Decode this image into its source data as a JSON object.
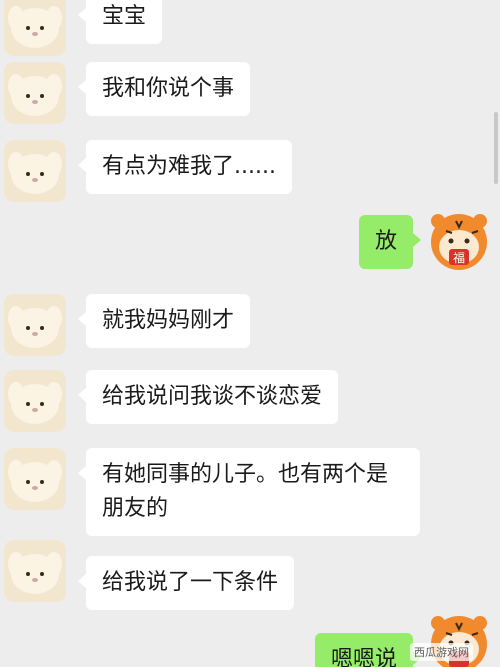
{
  "colors": {
    "background": "#ededed",
    "incoming_bubble": "#ffffff",
    "outgoing_bubble": "#95ec69"
  },
  "contact_avatar_icon": "puppy-sticker-avatar",
  "self_avatar_icon": "tiger-fu-avatar",
  "self_avatar_text": "福",
  "messages": [
    {
      "side": "in",
      "text": "宝宝"
    },
    {
      "side": "in",
      "text": "我和你说个事"
    },
    {
      "side": "in",
      "text": "有点为难我了......"
    },
    {
      "side": "out",
      "text": "放"
    },
    {
      "side": "in",
      "text": "就我妈妈刚才"
    },
    {
      "side": "in",
      "text": "给我说问我谈不谈恋爱"
    },
    {
      "side": "in",
      "text": "有她同事的儿子。也有两个是朋友的"
    },
    {
      "side": "in",
      "text": "给我说了一下条件"
    },
    {
      "side": "out",
      "text": "嗯嗯说"
    }
  ],
  "watermark": "西瓜游戏网"
}
